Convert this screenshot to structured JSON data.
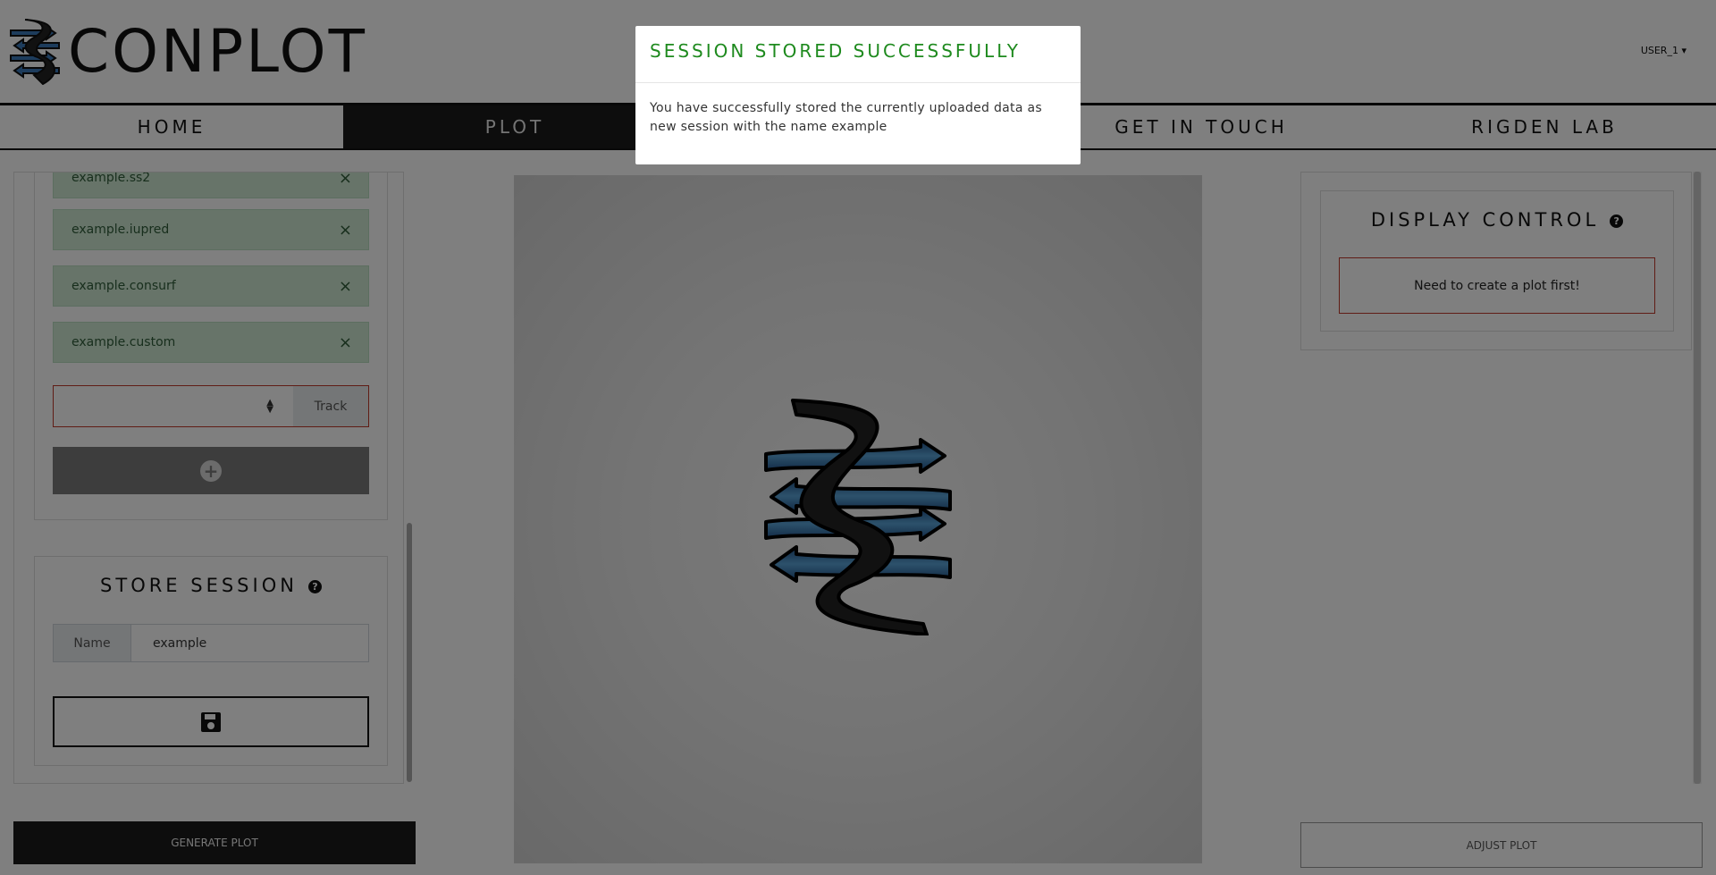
{
  "app": {
    "name": "CONPLOT"
  },
  "user_menu": {
    "label": "USER_1"
  },
  "nav": {
    "items": [
      {
        "label": "HOME"
      },
      {
        "label": "PLOT"
      },
      {
        "label": ""
      },
      {
        "label": "GET IN TOUCH"
      },
      {
        "label": "RIGDEN LAB"
      }
    ],
    "active_index": 1
  },
  "upload": {
    "files": [
      {
        "name": "example.ss2"
      },
      {
        "name": "example.iupred"
      },
      {
        "name": "example.consurf"
      },
      {
        "name": "example.custom"
      }
    ],
    "track_select": {
      "value": "",
      "label": "Track"
    }
  },
  "store_session": {
    "title": "STORE SESSION",
    "name_label": "Name",
    "name_value": "example"
  },
  "buttons": {
    "generate": "GENERATE PLOT",
    "adjust": "ADJUST PLOT"
  },
  "display_control": {
    "title": "DISPLAY CONTROL",
    "alert": "Need to create a plot first!"
  },
  "modal": {
    "title": "SESSION STORED SUCCESSFULLY",
    "body": "You have successfully stored the currently uploaded data as new session with the name example"
  },
  "colors": {
    "accent_dark": "#1a1a1a",
    "success_text": "#1e8a1e",
    "file_bg": "#cfe8d3",
    "alert_border": "#c0392b",
    "ribbon_blue": "#2f6fa8"
  }
}
